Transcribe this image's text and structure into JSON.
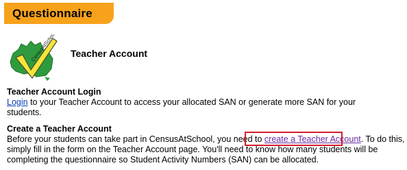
{
  "banner": {
    "title": "Questionnaire",
    "color": "#f7a21b"
  },
  "logo": {
    "icon": "australia-checkmark-logo-icon",
    "label": "CensusAtSchool"
  },
  "page": {
    "heading": "Teacher Account"
  },
  "login_section": {
    "title": "Teacher Account Login",
    "link_label": "Login",
    "text": " to your Teacher Account to access your allocated SAN or generate more SAN for your students."
  },
  "create_section": {
    "title": "Create a Teacher Account",
    "text_before": "Before your students can take part in CensusAtSchool, you need to ",
    "link_label": "create a Teacher Account",
    "text_after": ". To do this, simply fill in the form on the Teacher Account page. You'll need to know how many students will be completing the questionnaire so Student Activity Numbers (SAN) can be allocated."
  },
  "colors": {
    "link": "#0b3fb3",
    "visited_link": "#6b2aa0",
    "highlight": "#d31f2b"
  }
}
